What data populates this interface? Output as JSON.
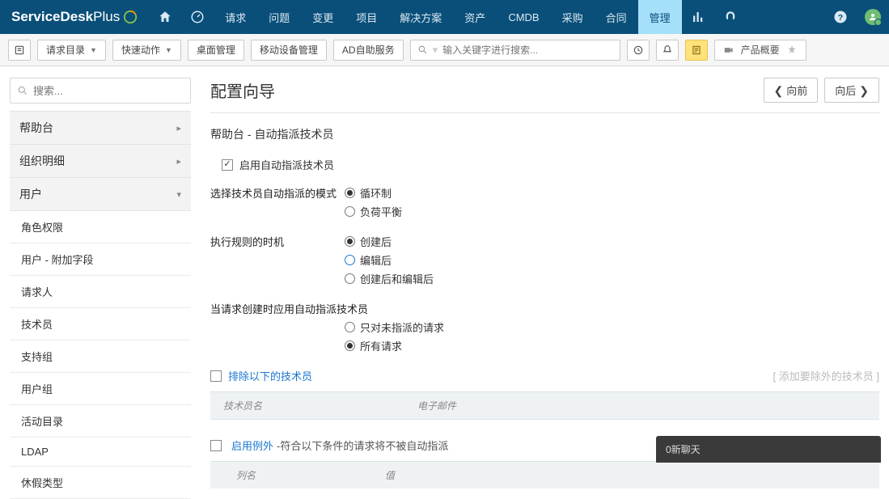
{
  "brand": {
    "part1": "ServiceDesk",
    "part2": " Plus"
  },
  "topnav": {
    "items": [
      "请求",
      "问题",
      "变更",
      "项目",
      "解决方案",
      "资产",
      "CMDB",
      "采购",
      "合同",
      "管理"
    ],
    "active_index": 9
  },
  "subbar": {
    "catalog": "请求目录",
    "quick_action": "快速动作",
    "desktop": "桌面管理",
    "mobile": "移动设备管理",
    "ad": "AD自助服务",
    "search_placeholder": "输入关键字进行搜索...",
    "product_overview": "产品概要"
  },
  "sidebar": {
    "search_placeholder": "搜索...",
    "groups": {
      "helpdesk": "帮助台",
      "org": "组织明细",
      "users": "用户"
    },
    "user_items": [
      "角色权限",
      "用户 - 附加字段",
      "请求人",
      "技术员",
      "支持组",
      "用户组",
      "活动目录",
      "LDAP",
      "休假类型"
    ]
  },
  "content": {
    "page_title": "配置向导",
    "btn_prev": "向前",
    "btn_next": "向后",
    "breadcrumb": "帮助台 - 自动指派技术员",
    "enable_label": "启用自动指派技术员",
    "mode_label": "选择技术员自动指派的模式",
    "mode_options": [
      "循环制",
      "负荷平衡"
    ],
    "mode_selected": 0,
    "timing_label": "执行规则的时机",
    "timing_options": [
      "创建后",
      "编辑后",
      "创建后和编辑后"
    ],
    "timing_selected": 0,
    "scope_label": "当请求创建时应用自动指派技术员",
    "scope_options": [
      "只对未指派的请求",
      "所有请求"
    ],
    "scope_selected": 1,
    "exclude_label": "排除以下的技术员",
    "add_exclude": "添加要除外的技术员",
    "table_headers": {
      "tech": "技术员名",
      "email": "电子邮件"
    },
    "exception_label": "启用例外",
    "exception_desc": "-符合以下条件的请求将不被自动指派",
    "table2_headers": {
      "col": "列名",
      "val": "值"
    }
  },
  "chat": {
    "label": "0新聊天"
  }
}
